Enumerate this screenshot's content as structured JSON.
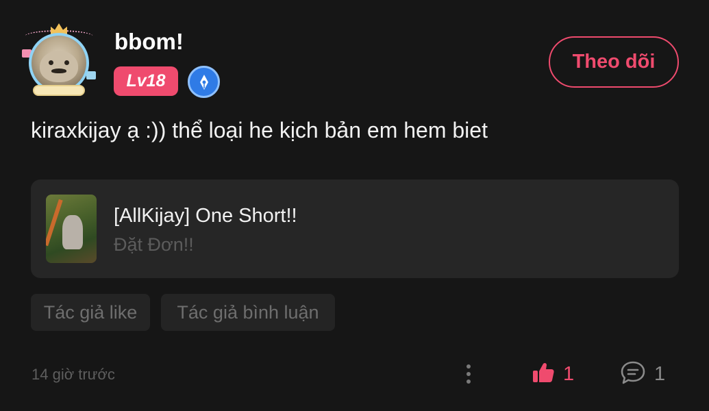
{
  "user": {
    "name": "bbom!",
    "level": "Lv18"
  },
  "follow_button": {
    "label": "Theo dõi"
  },
  "comment": {
    "text": "kiraxkijay ạ :)) thể loại he kịch bản em hem biet"
  },
  "story": {
    "title": "[AllKijay] One Short!!",
    "subtitle": "Đặt Đơn!!"
  },
  "tags": [
    "Tác giả like",
    "Tác giả bình luận"
  ],
  "footer": {
    "timestamp": "14 giờ trước",
    "like_count": "1",
    "comment_count": "1"
  },
  "colors": {
    "background": "#161616",
    "accent": "#ef4b6e",
    "card": "#262626",
    "tag_bg": "#242424",
    "muted": "#5e5e5e"
  },
  "icons": [
    "avatar-frame",
    "pen-badge-icon",
    "more-vertical-icon",
    "thumbs-up-icon",
    "comment-bubble-icon"
  ]
}
